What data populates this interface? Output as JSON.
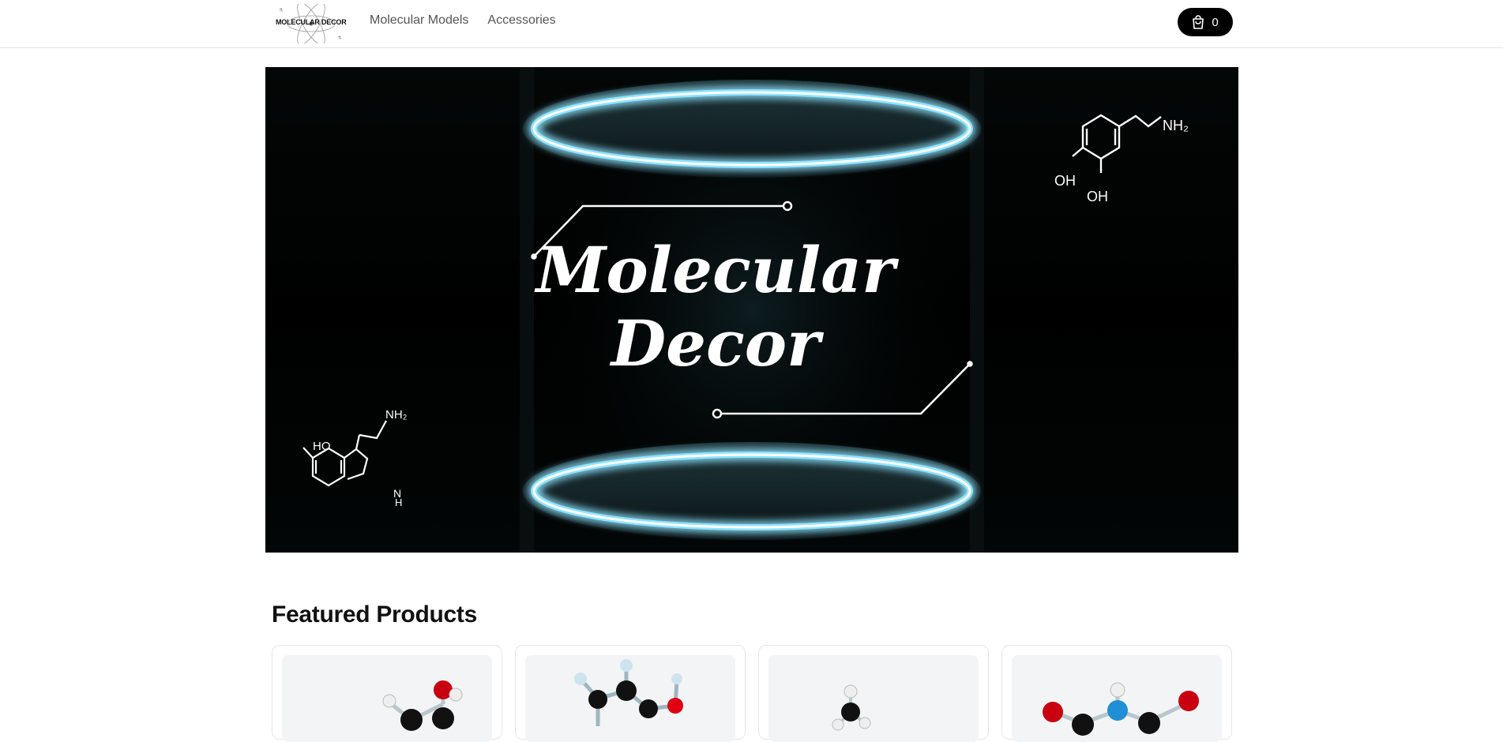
{
  "header": {
    "logo_text": "MOLECULAR DECOR",
    "nav": [
      {
        "label": "Molecular Models"
      },
      {
        "label": "Accessories"
      }
    ],
    "cart_count": "0"
  },
  "hero": {
    "title_line1": "Molecular",
    "title_line2": "Decor",
    "dopamine_nh2": "NH₂",
    "dopamine_oh1": "OH",
    "dopamine_oh2": "OH",
    "serotonin_nh2": "NH₂",
    "serotonin_ho": "HO",
    "serotonin_nh": "H",
    "serotonin_n": "N"
  },
  "featured": {
    "title": "Featured Products"
  },
  "colors": {
    "accent": "#000000",
    "ring_glow": "#8fe4ff",
    "atom_red": "#d0101a",
    "atom_blue": "#1f8fd6"
  }
}
